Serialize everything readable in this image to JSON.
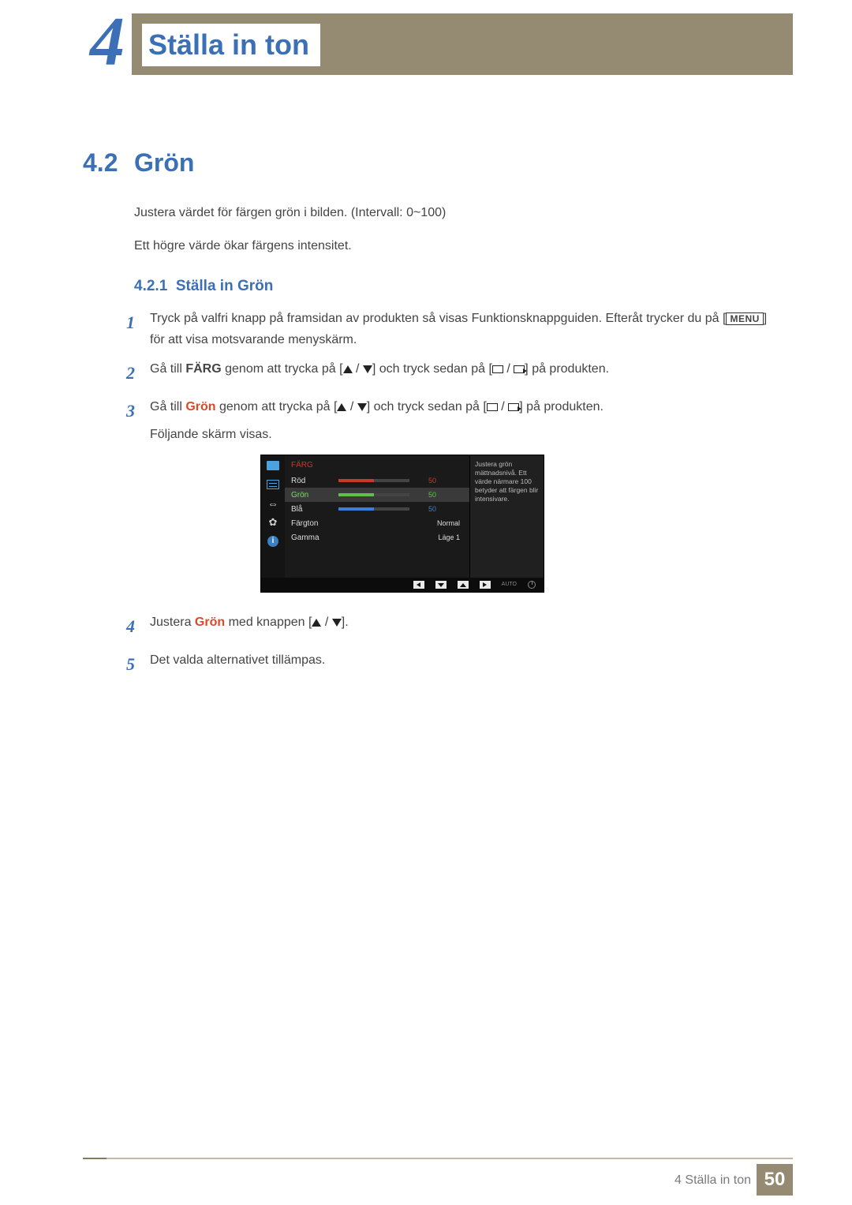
{
  "chapter": {
    "number": "4",
    "title": "Ställa in ton"
  },
  "section": {
    "number": "4.2",
    "title": "Grön"
  },
  "intro": {
    "p1": "Justera värdet för färgen grön i bilden. (Intervall: 0~100)",
    "p2": "Ett högre värde ökar färgens intensitet."
  },
  "subsection": {
    "number": "4.2.1",
    "title": "Ställa in Grön"
  },
  "steps": {
    "s1": {
      "num": "1",
      "a": "Tryck på valfri knapp på framsidan av produkten så visas Funktionsknappguiden. Efteråt trycker du på [",
      "menu": "MENU",
      "b": "] för att visa motsvarande menyskärm."
    },
    "s2": {
      "num": "2",
      "a": "Gå till ",
      "kw": "FÄRG",
      "b": " genom att trycka på [",
      "c": "] och tryck sedan på [",
      "d": "] på produkten."
    },
    "s3": {
      "num": "3",
      "a": "Gå till ",
      "kw": "Grön",
      "b": " genom att trycka på [",
      "c": "] och tryck sedan på [",
      "d": "] på produkten.",
      "e": "Följande skärm visas."
    },
    "s4": {
      "num": "4",
      "a": "Justera ",
      "kw": "Grön",
      "b": " med knappen [",
      "c": "]."
    },
    "s5": {
      "num": "5",
      "a": "Det valda alternativet tillämpas."
    }
  },
  "osd": {
    "title": "FÄRG",
    "rows": {
      "red": {
        "label": "Röd",
        "value": "50",
        "percent": 50,
        "color": "#c63a2b"
      },
      "green": {
        "label": "Grön",
        "value": "50",
        "percent": 50,
        "color": "#5fbf4a"
      },
      "blue": {
        "label": "Blå",
        "value": "50",
        "percent": 50,
        "color": "#3a7fd9"
      },
      "tone": {
        "label": "Färgton",
        "value": "Normal"
      },
      "gamma": {
        "label": "Gamma",
        "value": "Läge 1"
      }
    },
    "help": "Justera grön mättnadsnivå. Ett värde närmare 100 betyder att färgen blir intensivare.",
    "nav_auto": "AUTO"
  },
  "footer": {
    "text": "4 Ställa in ton",
    "page": "50"
  }
}
